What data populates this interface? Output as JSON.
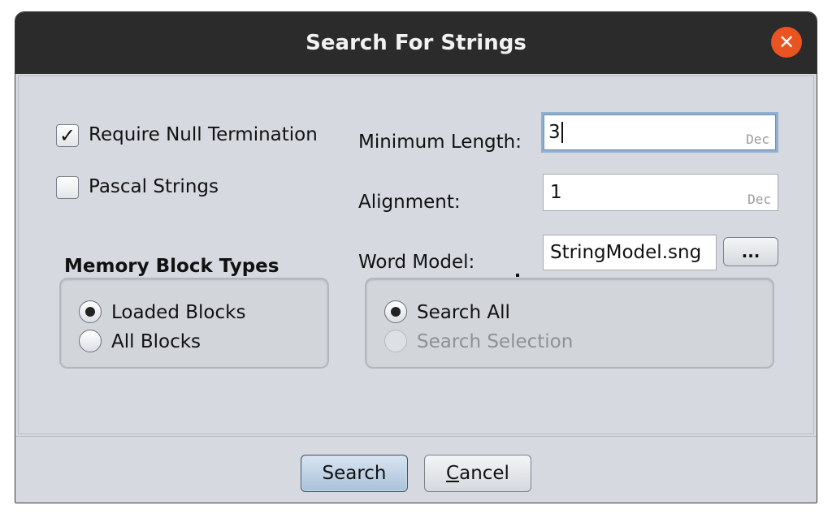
{
  "dialog": {
    "title": "Search For Strings",
    "close_symbol": "✕"
  },
  "options": {
    "null_termination": {
      "label": "Require Null Termination",
      "checked": true
    },
    "pascal_strings": {
      "label": "Pascal Strings",
      "checked": false
    }
  },
  "fields": {
    "minimum_length": {
      "label": "Minimum Length:",
      "value": "3",
      "radix": "Dec"
    },
    "alignment": {
      "label": "Alignment:",
      "value": "1",
      "radix": "Dec"
    },
    "word_model": {
      "label": "Word Model:",
      "value": "StringModel.sng",
      "browse_label": "..."
    }
  },
  "memory_block_types": {
    "heading": "Memory Block Types",
    "options": [
      {
        "label": "Loaded Blocks",
        "selected": true,
        "enabled": true
      },
      {
        "label": "All Blocks",
        "selected": false,
        "enabled": true
      }
    ]
  },
  "search_scope": {
    "options": [
      {
        "label": "Search All",
        "selected": true,
        "enabled": true
      },
      {
        "label": "Search Selection",
        "selected": false,
        "enabled": false
      }
    ]
  },
  "buttons": {
    "search": "Search",
    "cancel_mnemonic": "C",
    "cancel_rest": "ancel"
  },
  "icons": {
    "close": "close-icon",
    "checkmark": "checkmark-icon",
    "browse": "ellipsis-icon"
  },
  "colors": {
    "titlebar": "#2b2b2b",
    "close_button": "#e95420",
    "focus_ring": "#8fb0d0",
    "default_button": "#a9c1d8"
  }
}
